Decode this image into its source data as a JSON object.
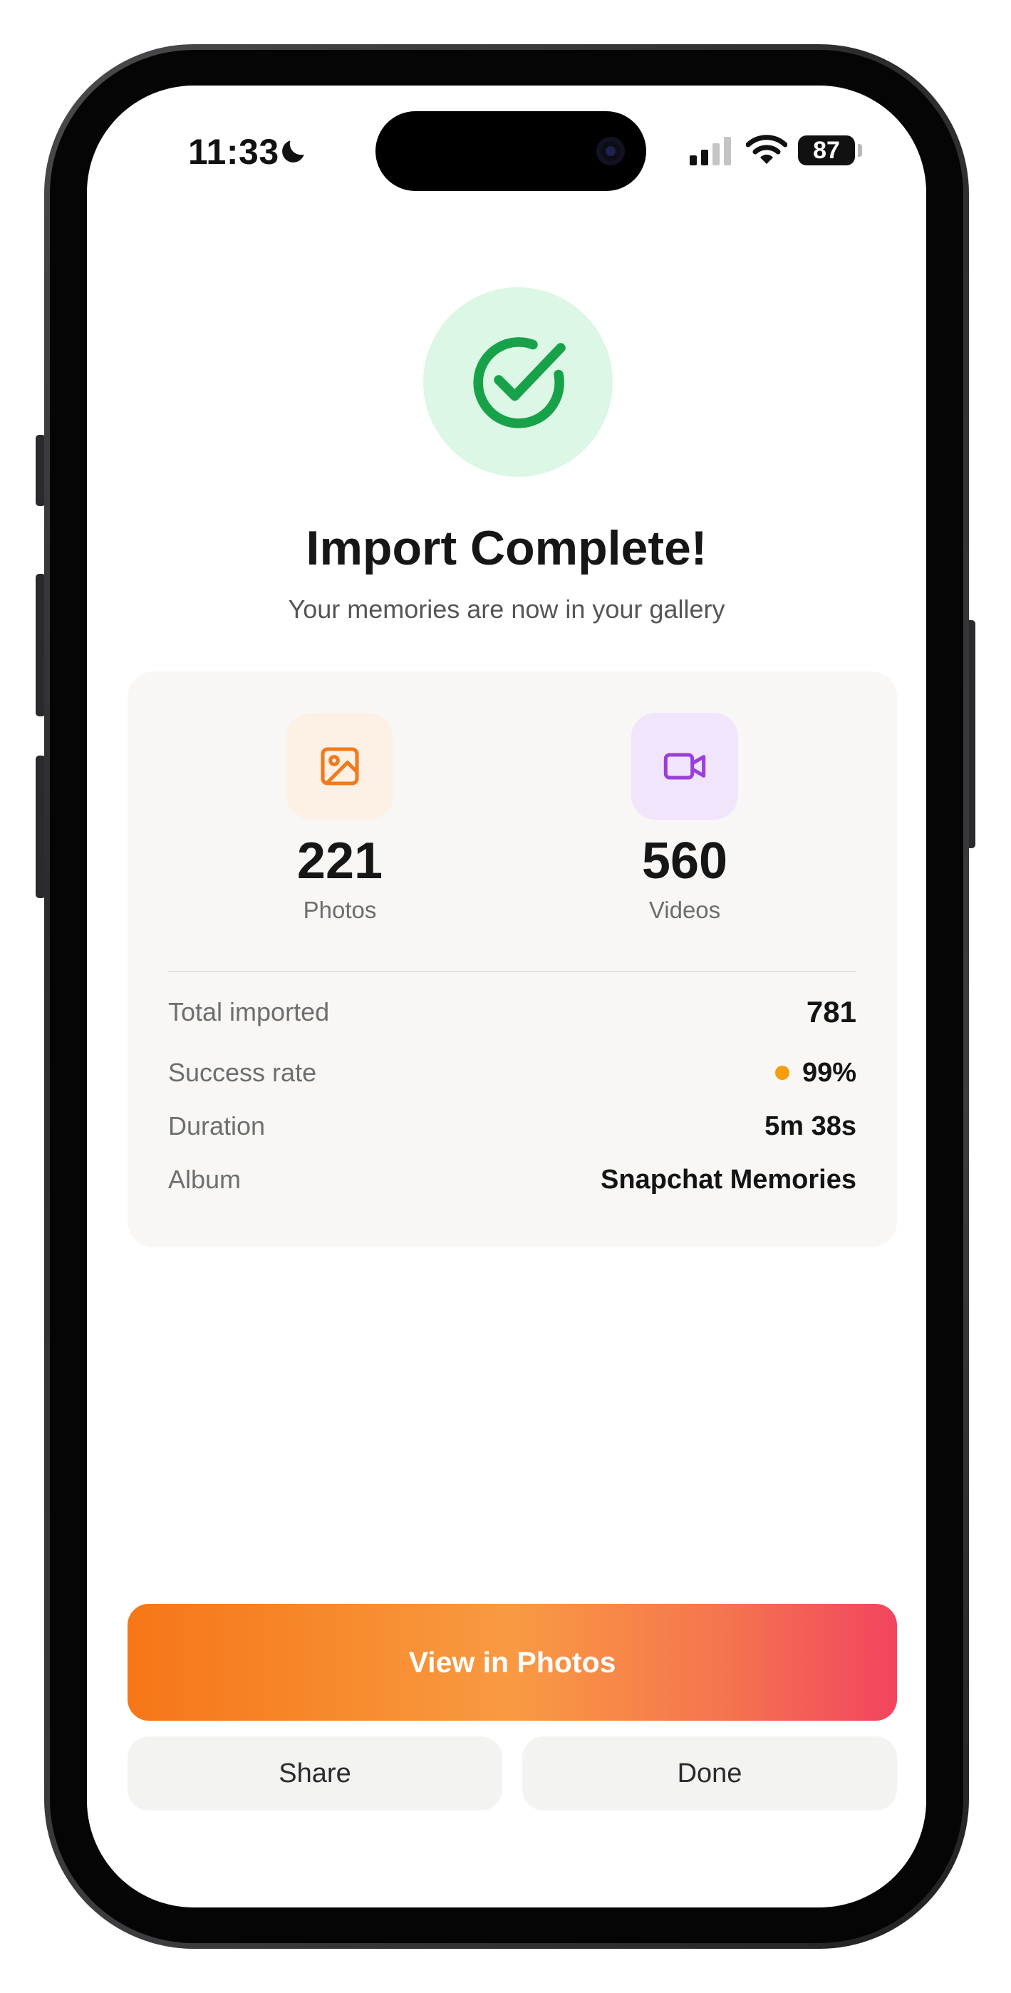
{
  "status_bar": {
    "time": "11:33",
    "battery_level": "87",
    "icons": [
      "moon-icon",
      "signal-icon",
      "wifi-icon",
      "battery-icon"
    ]
  },
  "header": {
    "icon": "checkmark-circle-icon",
    "title": "Import Complete!",
    "subtitle": "Your memories are now in your gallery"
  },
  "summary": {
    "stats": [
      {
        "icon": "photo-icon",
        "value": "221",
        "label": "Photos",
        "accent": "#f07a1d"
      },
      {
        "icon": "video-camera-icon",
        "value": "560",
        "label": "Videos",
        "accent": "#9b3fdc"
      }
    ],
    "details": [
      {
        "label": "Total imported",
        "value": "781"
      },
      {
        "label": "Success rate",
        "value": "99%",
        "indicator_color": "#f59e0b"
      },
      {
        "label": "Duration",
        "value": "5m 38s"
      },
      {
        "label": "Album",
        "value": "Snapchat Memories"
      }
    ]
  },
  "actions": {
    "primary_label": "View in Photos",
    "share_label": "Share",
    "done_label": "Done"
  },
  "colors": {
    "success_green": "#17a24a",
    "success_bg": "#dcf7e5",
    "gradient_start": "#f67617",
    "gradient_end": "#f2445f"
  }
}
